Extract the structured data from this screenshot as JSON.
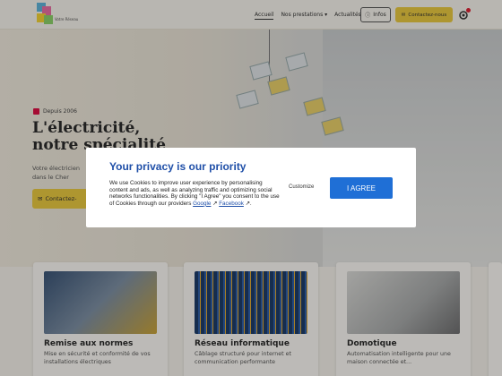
{
  "header": {
    "logo_text": "Votre Réseau",
    "nav": [
      "Accueil",
      "Nos prestations",
      "Actualités"
    ],
    "nav_active": 0,
    "info_button": "Infos",
    "contact_button": "Contactez-nous"
  },
  "hero": {
    "since": "Depuis 2006",
    "title_line1": "L'électricité,",
    "title_line2": "notre spécialité",
    "subtitle_line1": "Votre électricien",
    "subtitle_line2": "dans le Cher",
    "cta": "Contactez-"
  },
  "cookie_modal": {
    "title": "Your privacy is our priority",
    "text": "We use Cookies to improve user experience by personalising content and ads, as well as analyzing traffic and optimizing social networks functionalities. By clicking \"I Agree\" you consent to the use of Cookies through our providers",
    "link_google": "Google",
    "link_facebook": "Facebook",
    "customize": "Customize",
    "agree": "I AGREE"
  },
  "cards": [
    {
      "title": "Remise aux normes",
      "desc": "Mise en sécurité et conformité de vos installations électriques"
    },
    {
      "title": "Réseau informatique",
      "desc": "Câblage structuré pour internet et communication performante"
    },
    {
      "title": "Domotique",
      "desc": "Automatisation intelligente pour une maison connectée et..."
    }
  ],
  "colors": {
    "accent": "#e8c840",
    "modal_blue": "#1f4fa8",
    "agree_blue": "#1f6fd6"
  }
}
